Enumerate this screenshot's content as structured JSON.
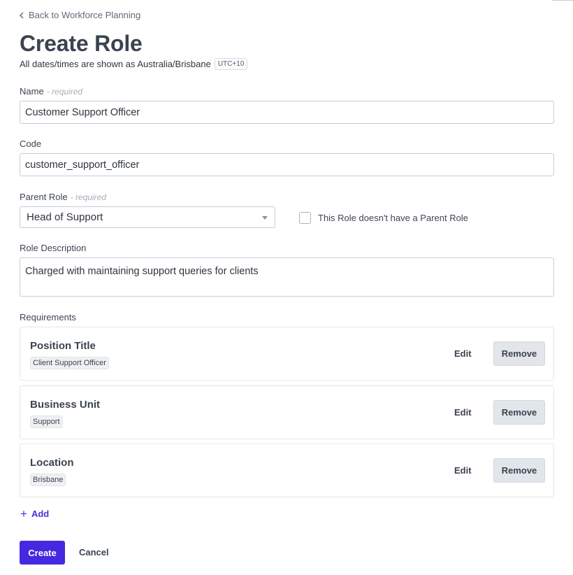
{
  "nav": {
    "back_label": "Back to Workforce Planning"
  },
  "page": {
    "title": "Create Role",
    "timezone_text": "All dates/times are shown as Australia/Brisbane",
    "timezone_badge": "UTC+10"
  },
  "form": {
    "required_marker": "- required",
    "name": {
      "label": "Name",
      "value": "Customer Support Officer"
    },
    "code": {
      "label": "Code",
      "value": "customer_support_officer"
    },
    "parent_role": {
      "label": "Parent Role",
      "selected": "Head of Support",
      "no_parent_label": "This Role doesn't have a Parent Role",
      "no_parent_checked": false
    },
    "description": {
      "label": "Role Description",
      "value": "Charged with maintaining support queries for clients"
    }
  },
  "requirements": {
    "label": "Requirements",
    "items": [
      {
        "title": "Position Title",
        "value": "Client Support Officer"
      },
      {
        "title": "Business Unit",
        "value": "Support"
      },
      {
        "title": "Location",
        "value": "Brisbane"
      }
    ],
    "edit_label": "Edit",
    "remove_label": "Remove",
    "add_label": "Add"
  },
  "actions": {
    "create_label": "Create",
    "cancel_label": "Cancel"
  },
  "colors": {
    "primary": "#4528df",
    "text": "#3a4350",
    "border": "#c6cbd2"
  },
  "icons": {
    "back": "chevron-left-icon",
    "add": "plus-icon",
    "dropdown": "caret-down-icon"
  }
}
